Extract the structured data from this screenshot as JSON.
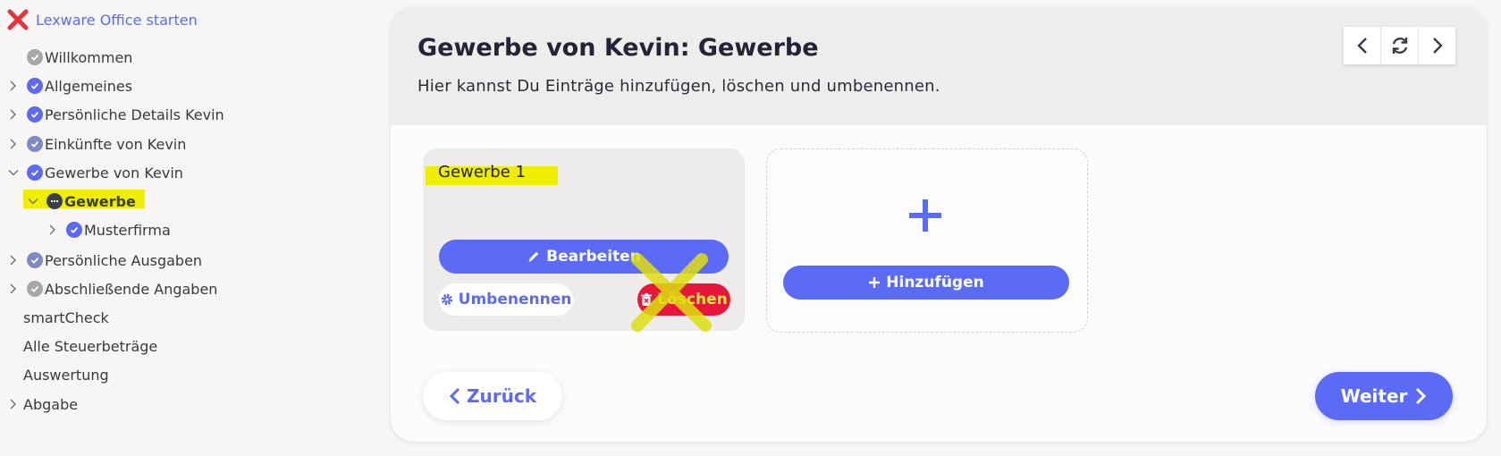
{
  "sidebar": {
    "brand_label": "Lexware Office starten",
    "items": [
      {
        "label": "Willkommen"
      },
      {
        "label": "Allgemeines"
      },
      {
        "label": "Persönliche Details Kevin"
      },
      {
        "label": "Einkünfte von Kevin"
      },
      {
        "label": "Gewerbe von Kevin"
      },
      {
        "label": "Gewerbe"
      },
      {
        "label": "Musterfirma"
      },
      {
        "label": "Persönliche Ausgaben"
      },
      {
        "label": "Abschließende Angaben"
      },
      {
        "label": "smartCheck"
      },
      {
        "label": "Alle Steuerbeträge"
      },
      {
        "label": "Auswertung"
      },
      {
        "label": "Abgabe"
      }
    ]
  },
  "header": {
    "title": "Gewerbe von Kevin: Gewerbe",
    "subtitle": "Hier kannst Du Einträge hinzufügen, löschen und umbenennen."
  },
  "entry_card": {
    "title": "Gewerbe 1",
    "edit_label": "Bearbeiten",
    "rename_label": "Umbenennen",
    "delete_label": "Löschen"
  },
  "add_card": {
    "add_label": "Hinzufügen"
  },
  "footer": {
    "back_label": "Zurück",
    "next_label": "Weiter"
  },
  "colors": {
    "accent": "#5b6bf5",
    "danger": "#e8163c",
    "highlight": "#f0ee00"
  }
}
